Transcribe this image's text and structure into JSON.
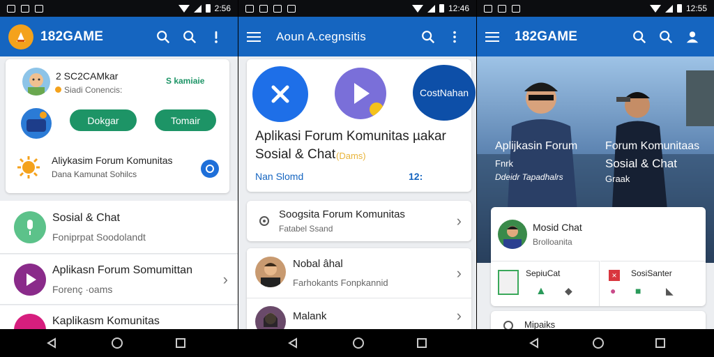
{
  "status": {
    "time1": "2:56",
    "time2": "12:46",
    "time3": "12:55"
  },
  "screen1": {
    "app_title": "182GAME",
    "profile_name": "2 SC2CAMkar",
    "profile_sub": "Siadi Conencis:",
    "profile_action": "S kamiaie",
    "btn_left": "Dokgar",
    "btn_right": "Tomair",
    "feature_title": "Aliykasim Forum Komunitas",
    "feature_sub": "Dana Kamunat Sohilcs",
    "list": [
      {
        "title": "Sosial & Chat",
        "sub": "Foniprpat Soodolandt"
      },
      {
        "title": "Aplikasn Forum Somumittan",
        "sub": "Forenç ·oams"
      },
      {
        "title": "Kaplikasm Komunitas",
        "sub": ""
      }
    ]
  },
  "screen2": {
    "app_title": "Aoun A.cegnsitis",
    "hero_icon_label": "CostNahan",
    "hero_title_1": "Aplikasi Forum Komunitas µakar",
    "hero_title_2": "Sosial & Chat",
    "hero_title_tag": "(Dams)",
    "hero_link": "Nan Slomd",
    "hero_count": "12:",
    "list": [
      {
        "title": "Soogsita Forum Komunitas",
        "sub": "Fatabel Ssand"
      },
      {
        "title": "Nobal âhal",
        "sub": "Farhokants Fonpkannid"
      },
      {
        "title": "Malank",
        "sub": ""
      }
    ]
  },
  "screen3": {
    "app_title": "182GAME",
    "banner_left_1": "Aplijkasin Forum",
    "banner_left_2": "Fnrk",
    "banner_left_3": "Ddeidr Tapadhalrs",
    "banner_right_1": "Forum Komunitaas",
    "banner_right_2": "Sosial & Chat",
    "banner_right_3": "Graak",
    "card_title": "Mosid Chat",
    "card_sub": "Brolloanita",
    "tile_left": "SepiuCat",
    "tile_right": "SosiSanter",
    "bottom_row": "Mipaiks"
  },
  "colors": {
    "appbar": "#1565c0",
    "accent_green": "#1d9466",
    "link_blue": "#1565c0"
  }
}
